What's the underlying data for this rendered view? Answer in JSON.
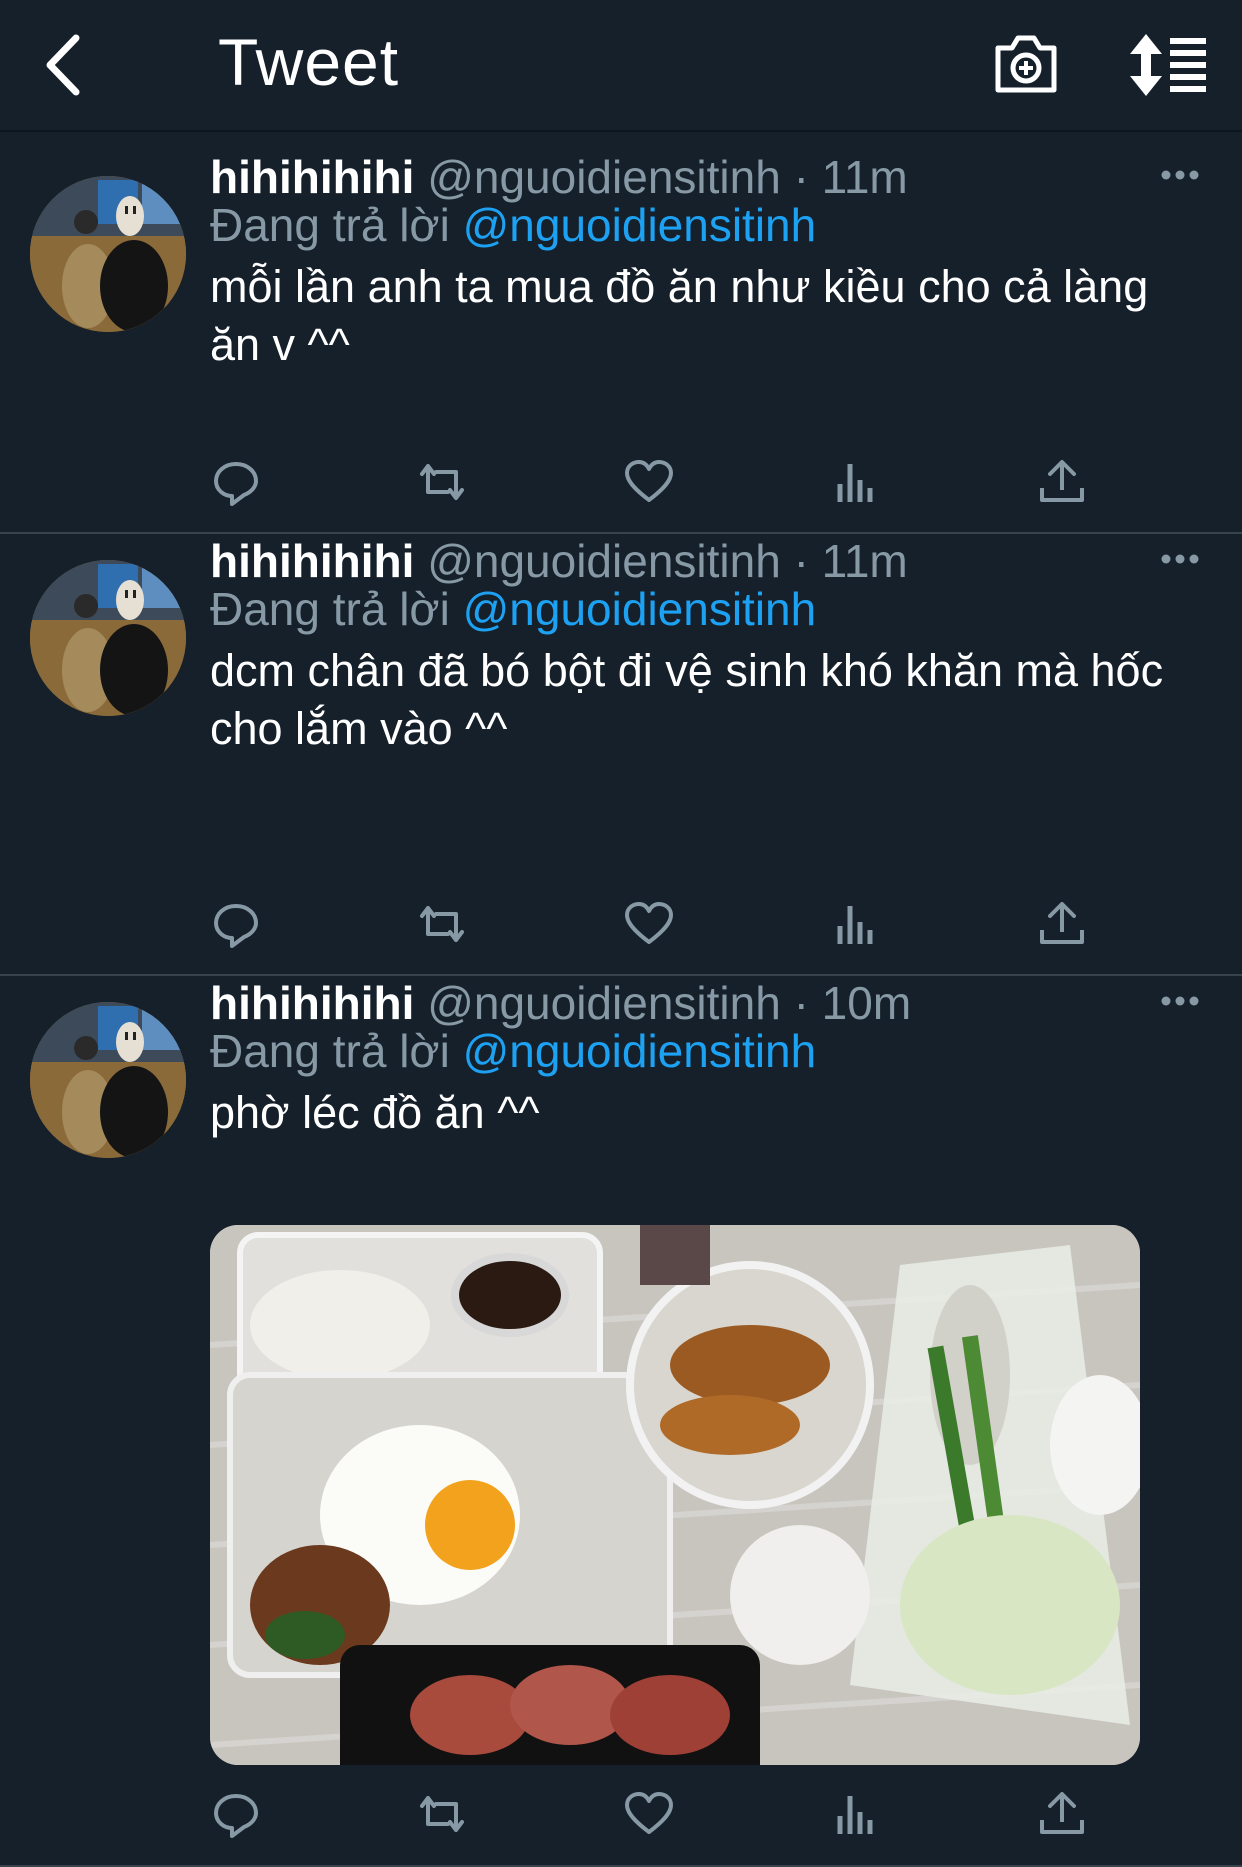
{
  "header": {
    "title": "Tweet"
  },
  "tweets": [
    {
      "name": "hihihihihi",
      "handle_time": "@nguoidiensitinh · 11m",
      "reply_prefix": "Đang trả lời",
      "reply_to": "@nguoidiensitinh",
      "text": "mỗi lần anh ta mua đồ ăn như kiều cho cả làng ăn v ^^"
    },
    {
      "name": "hihihihihi",
      "handle_time": "@nguoidiensitinh · 11m",
      "reply_prefix": "Đang trả lời",
      "reply_to": "@nguoidiensitinh",
      "text": "dcm chân đã bó bột đi vệ sinh khó khăn mà hốc cho lắm vào ^^"
    },
    {
      "name": "hihihihihi",
      "handle_time": "@nguoidiensitinh · 10m",
      "reply_prefix": "Đang trả lời",
      "reply_to": "@nguoidiensitinh",
      "text": "phờ léc đồ ăn ^^"
    }
  ],
  "icons": {
    "back": "chevron-left-icon",
    "camera": "camera-add-icon",
    "sort": "sort-icon",
    "reply": "reply-icon",
    "retweet": "retweet-icon",
    "like": "heart-icon",
    "analytics": "analytics-icon",
    "share": "share-icon",
    "more": "more-icon"
  },
  "colors": {
    "background": "#15202b",
    "accent": "#1da1f2",
    "muted": "#8899a6",
    "divider": "#38444d"
  }
}
